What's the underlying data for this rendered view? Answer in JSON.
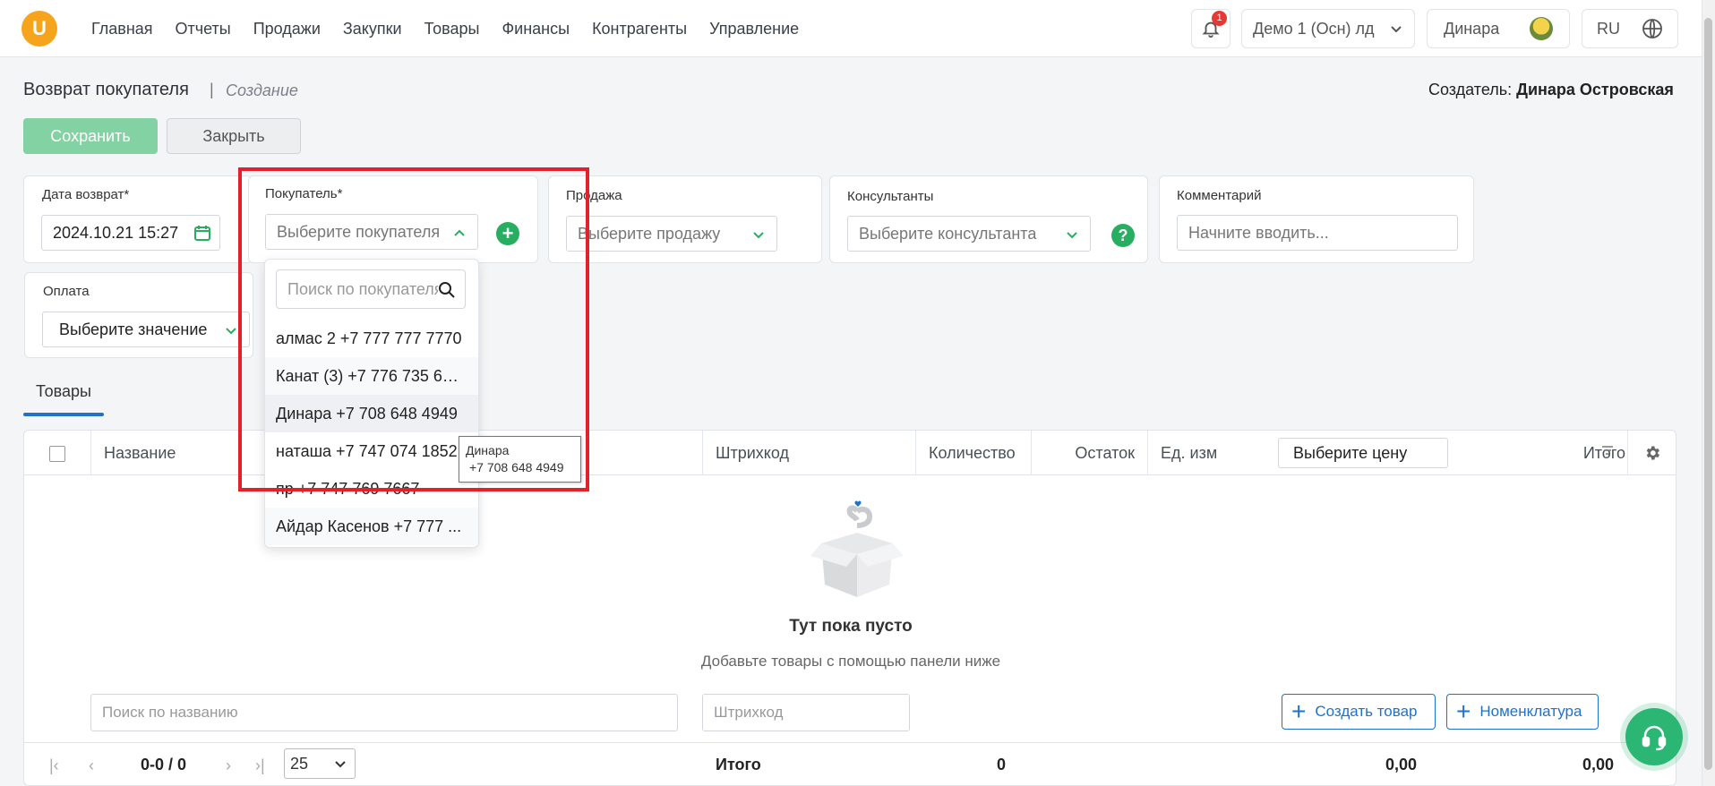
{
  "app": {
    "logo_letter": "U"
  },
  "nav": {
    "items": [
      "Главная",
      "Отчеты",
      "Продажи",
      "Закупки",
      "Товары",
      "Финансы",
      "Контрагенты",
      "Управление"
    ]
  },
  "header": {
    "notifications_count": "1",
    "organization": "Демо 1 (Осн) лд",
    "user_name": "Динара",
    "language": "RU"
  },
  "page": {
    "title": "Возврат покупателя",
    "separator": "|",
    "mode": "Создание",
    "creator_label": "Создатель:",
    "creator_name": "Динара Островская",
    "save_label": "Сохранить",
    "close_label": "Закрыть"
  },
  "form": {
    "return_date_label": "Дата возврат*",
    "return_date_value": "2024.10.21 15:27",
    "buyer_label": "Покупатель*",
    "buyer_placeholder": "Выберите покупателя",
    "sale_label": "Продажа",
    "sale_placeholder": "Выберите продажу",
    "consultants_label": "Консультанты",
    "consultants_placeholder": "Выберите консультанта",
    "comment_label": "Комментарий",
    "comment_placeholder": "Начните вводить...",
    "payment_label": "Оплата",
    "payment_placeholder": "Выберите значение"
  },
  "buyer_dropdown": {
    "search_placeholder": "Поиск по покупателям",
    "items": [
      "алмас 2 +7 777 777 7770",
      "Канат (3) +7 776 735 63...",
      "Динара +7 708 648 4949",
      "наташа +7 747 074 1852",
      "пр +7 747 769 7667",
      "Айдар Касенов +7 777 ..."
    ],
    "hovered_index": 2,
    "tooltip_name": "Динара",
    "tooltip_phone": "+7 708 648 4949"
  },
  "tabs": {
    "products": "Товары"
  },
  "table": {
    "columns": {
      "name": "Название",
      "barcode": "Штрихкод",
      "quantity": "Количество",
      "remainder": "Остаток",
      "unit": "Ед. изм",
      "price_select": "Выберите цену",
      "total": "Итого"
    },
    "empty_title": "Тут пока пусто",
    "empty_subtitle": "Добавьте товары с помощью панели ниже",
    "search_name_placeholder": "Поиск по названию",
    "barcode_placeholder": "Штрихкод",
    "create_product_label": "Создать товар",
    "nomenclature_label": "Номенклатура"
  },
  "footer": {
    "pager_text": "0-0 / 0",
    "per_page": "25",
    "total_label": "Итого",
    "total_quantity": "0",
    "total_price_sum": "0,00",
    "total_sum": "0,00"
  },
  "colors": {
    "accent_green": "#27ae60",
    "accent_blue": "#1e73c8",
    "highlight_red": "#e3202b"
  }
}
